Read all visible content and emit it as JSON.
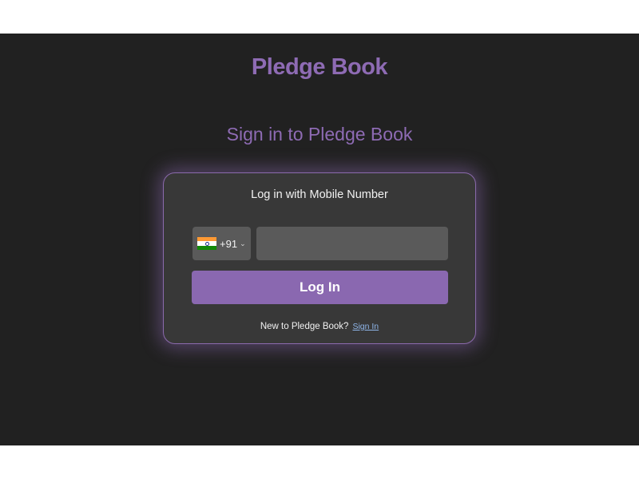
{
  "app": {
    "brand": "Pledge Book",
    "heading": "Sign in to Pledge Book"
  },
  "login_card": {
    "title": "Log in with Mobile Number",
    "country_code": "+91",
    "country_flag": "india-flag-icon",
    "phone_value": "",
    "login_button": "Log In",
    "footer_text": "New to Pledge Book?",
    "signin_link": "Sign In"
  },
  "colors": {
    "background": "#212121",
    "card": "#383838",
    "accent": "#8a68b0",
    "link": "#8fb6ea"
  }
}
